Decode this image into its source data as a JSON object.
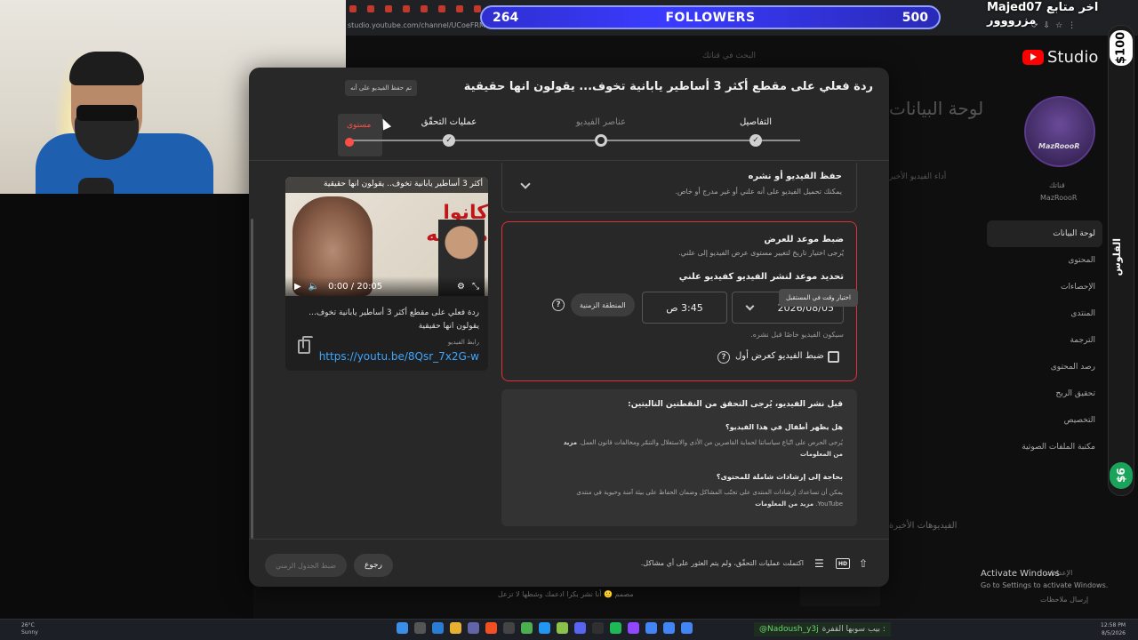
{
  "overlay": {
    "followers_left": "264",
    "followers_label": "FOLLOWERS",
    "followers_right": "500",
    "top_name": "Majed07",
    "top_label": "اخر متابع مزرووور",
    "money_top": "$100",
    "money_bottom": "$6",
    "side_label": "الفلوس"
  },
  "browser": {
    "url": "studio.youtube.com/channel/UCoeFRM6koXzGKd"
  },
  "studio": {
    "logo": "Studio",
    "search_placeholder": "البحث في قناتك",
    "channel_avatar_text": "MazRoooR",
    "channel_label": "قناتك",
    "channel_name": "MazRoooR",
    "bg_title": "لوحة البيانات",
    "bg_subtitle": "أداء الفيديو الأخير",
    "bg_videos": "الفيديوهات الأخيرة",
    "nav": [
      "لوحة البيانات",
      "المحتوى",
      "الإحصاءات",
      "المنتدى",
      "الترجمة",
      "رصد المحتوى",
      "تحقيق الربح",
      "التخصيص",
      "مكتبة الملفات الصوتية"
    ],
    "settings": "الإعدادات",
    "feedback": "إرسال ملاحظات",
    "activate_title": "Activate Windows",
    "activate_sub": "Go to Settings to activate Windows."
  },
  "modal": {
    "title": "ردة فعلي على مقطع أكثر 3 أساطير يابانية تخوف... يقولون انها حقيقية",
    "saved_chip": "تم حفظ الفيديو على أنه",
    "steps": [
      {
        "label": "التفاصيل",
        "state": "done"
      },
      {
        "label": "عناصر الفيديو",
        "state": "open"
      },
      {
        "label": "عمليات التحقّق",
        "state": "done"
      },
      {
        "label": "مستوى",
        "state": "active"
      }
    ],
    "video_card": {
      "thumb_title": "أكثر 3 أساطير يابانية تخوف.. يقولون انها حقيقية",
      "thumb_caption": "كانوا مخبينه",
      "time": "0:00 / 20:05",
      "title": "ردة فعلي على مقطع أكثر 3 أساطير يابانية تخوف... يقولون انها حقيقية",
      "link_label": "رابط الفيديو",
      "link": "https://youtu.be/8Qsr_7x2G-w"
    },
    "save_publish": {
      "title": "حفظ الفيديو أو نشره",
      "desc": "يمكنك تحميل الفيديو على أنه علني أو غير مدرج أو خاص."
    },
    "tooltip": "اختيار وقت في المستقبل",
    "schedule": {
      "title": "ضبط موعد للعرض",
      "desc": "يُرجى اختيار تاريخ لتغيير مستوى عرض الفيديو إلى علني.",
      "sub": "تحديد موعد لنشر الفيديو كفيديو علني",
      "date": "2026/08/05",
      "time": "3:45 ص",
      "timezone": "المنطقة الزمنية",
      "note": "سيكون الفيديو خاصًا قبل نشره.",
      "premiere": "ضبط الفيديو كعرض أول"
    },
    "checks": {
      "heading": "قبل نشر الفيديو، يُرجى التحقق من النقطتين التاليتين:",
      "q1": "هل يظهر أطفال في هذا الفيديو؟",
      "d1": "يُرجى الحرص على اتّباع سياساتنا لحماية القاصرين من الأذى والاستغلال والتنمّر ومخالفات قانون العمل.",
      "d1_link": "مزيد من المعلومات",
      "q2": "بحاجة إلى إرشادات شاملة للمحتوى؟",
      "d2": "يمكن أن تساعدك إرشادات المنتدى على تجنّب المشاكل وضمان الحفاظ على بيئة آمنة وحيوية في منتدى YouTube.",
      "d2_link": "مزيد من المعلومات"
    },
    "footer": {
      "message": "اكتملت عمليات التحقّق، ولم يتم العثور على أي مشاكل.",
      "back": "رجوع",
      "schedule_btn": "ضبط الجدول الزمني",
      "hd": "HD"
    }
  },
  "below_modal": "مصمم 🙂 أنا نشر بكرا ادعمك وشطها لا تزعل",
  "taskbar": {
    "chat_user": "@Nadoush_y3j",
    "chat_msg": "بيب سوبها القفرة :",
    "time": "12:58 PM",
    "date": "8/5/2026",
    "weather_temp": "26°C",
    "weather_desc": "Sunny"
  }
}
